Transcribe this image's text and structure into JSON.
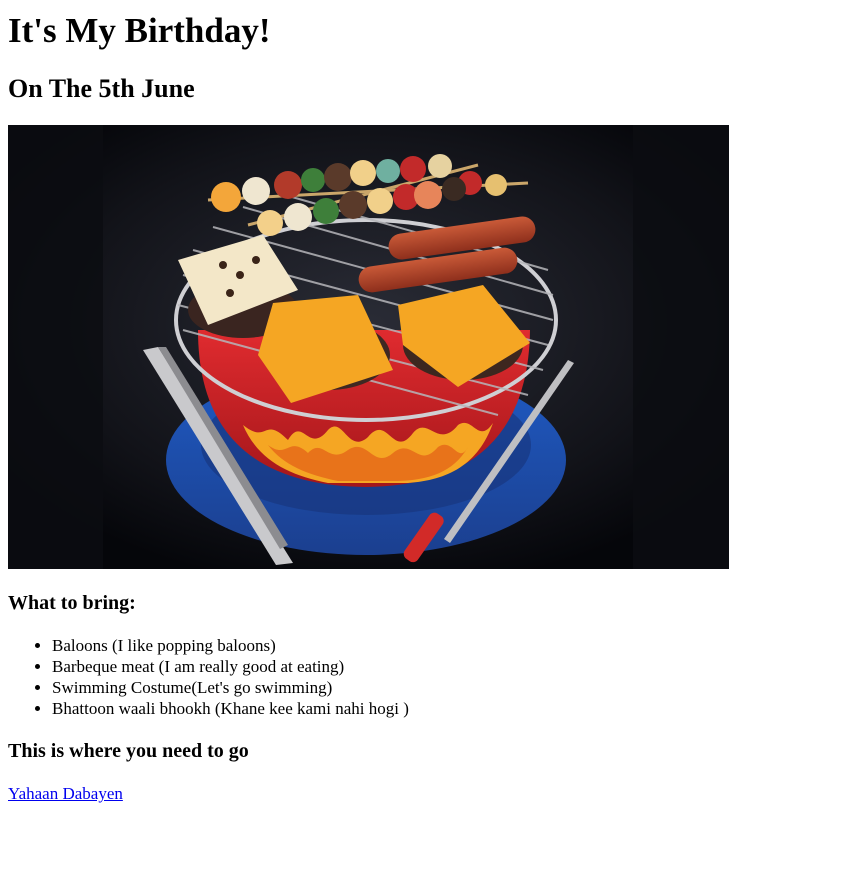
{
  "page": {
    "title": "It's My Birthday!",
    "subtitle": "On The 5th June"
  },
  "image": {
    "alt": "Barbecue grill birthday cake"
  },
  "bring": {
    "heading": "What to bring:",
    "items": [
      "Baloons (I like popping baloons)",
      "Barbeque meat (I am really good at eating)",
      "Swimming Costume(Let's go swimming)",
      "Bhattoon waali bhookh (Khane kee kami nahi hogi )"
    ]
  },
  "location": {
    "heading": "This is where you need to go",
    "link_text": "Yahaan Dabayen"
  },
  "colors": {
    "link": "#0000ee",
    "cake_red": "#d8262a",
    "plate_blue": "#2a6fd6",
    "cheese_orange": "#f5a623",
    "sausage": "#b4452a"
  }
}
